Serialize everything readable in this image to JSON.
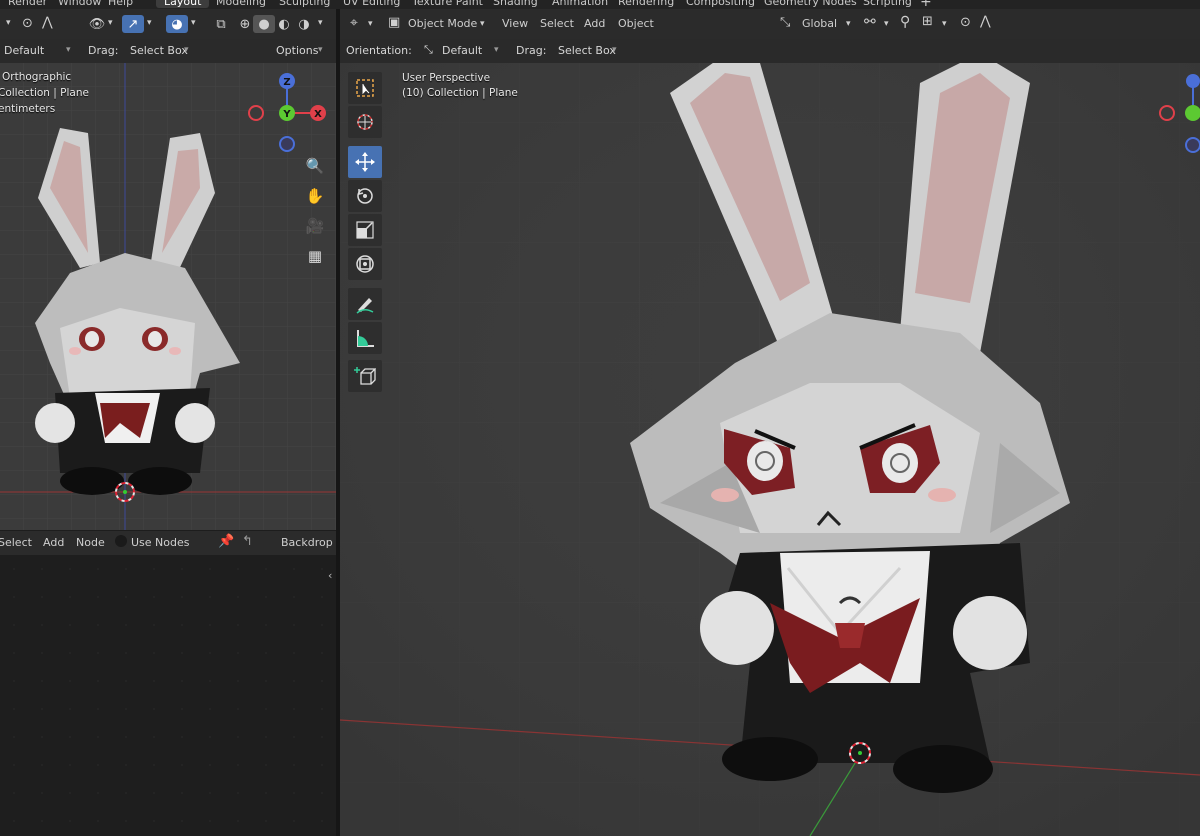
{
  "workspace_tabs": [
    "Render",
    "Window",
    "Help",
    "Layout",
    "Modeling",
    "Sculpting",
    "UV Editing",
    "Texture Paint",
    "Shading",
    "Animation",
    "Rendering",
    "Compositing",
    "Geometry Nodes",
    "Scripting",
    "+"
  ],
  "active_tab": "Layout",
  "left_viewport": {
    "orientation_value": "Default",
    "drag_label": "Drag:",
    "drag_value": "Select Box",
    "options_label": "Options",
    "overlay_lines": [
      "Orthographic",
      "Collection | Plane",
      "entimeters"
    ],
    "axes": {
      "z": "Z",
      "y": "Y",
      "x": "X"
    }
  },
  "node_editor": {
    "menu": [
      "Select",
      "Add",
      "Node"
    ],
    "use_nodes_label": "Use Nodes",
    "backdrop_label": "Backdrop"
  },
  "main_viewport": {
    "mode_label": "Object Mode",
    "menu": [
      "View",
      "Select",
      "Add",
      "Object"
    ],
    "transform_orientation": "Global",
    "orientation_label": "Orientation:",
    "orientation_value": "Default",
    "drag_label": "Drag:",
    "drag_value": "Select Box",
    "overlay_lines": [
      "User Perspective",
      "(10) Collection | Plane"
    ]
  },
  "colors": {
    "accent": "#4772b3",
    "x_axis": "#e0404a",
    "y_axis": "#5cc932",
    "z_axis": "#4a6fd8",
    "viewport_bg": "#3d3d3d"
  }
}
